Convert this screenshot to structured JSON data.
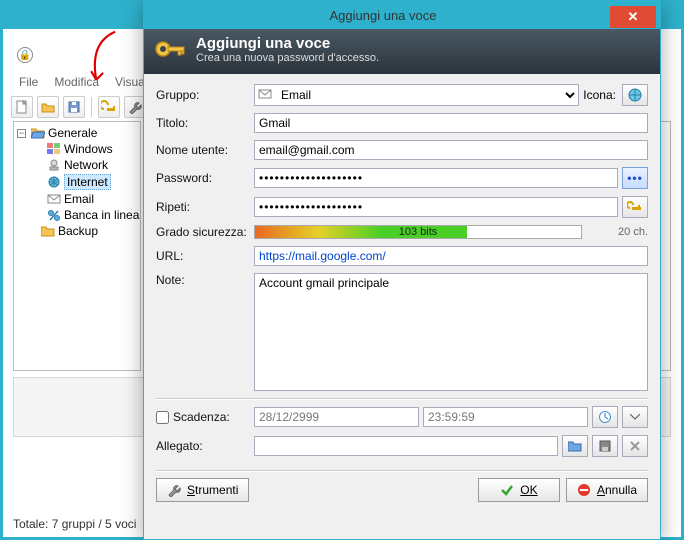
{
  "mainwin": {
    "menu": {
      "file": "File",
      "edit": "Modifica",
      "view": "Visual"
    }
  },
  "tree": {
    "root": "Generale",
    "items": [
      "Windows",
      "Network",
      "Internet",
      "Email",
      "Banca in linea"
    ],
    "backup": "Backup"
  },
  "status": "Totale: 7 gruppi / 5 voci",
  "dialog": {
    "window_title": "Aggiungi una voce",
    "heading": "Aggiungi una voce",
    "subheading": "Crea una nuova password d'accesso.",
    "labels": {
      "gruppo": "Gruppo:",
      "icona": "Icona:",
      "titolo": "Titolo:",
      "nome_utente": "Nome utente:",
      "password": "Password:",
      "ripeti": "Ripeti:",
      "grado": "Grado sicurezza:",
      "url": "URL:",
      "note": "Note:",
      "scadenza": "Scadenza:",
      "allegato": "Allegato:"
    },
    "values": {
      "gruppo": "Email",
      "titolo": "Gmail",
      "nome_utente": "email@gmail.com",
      "password": "••••••••••••••••••••",
      "ripeti": "••••••••••••••••••••",
      "strength_bits": "103 bits",
      "char_count": "20 ch.",
      "url": "https://mail.google.com/",
      "note": "Account gmail principale",
      "scadenza_date": "28/12/2999",
      "scadenza_time": "23:59:59",
      "allegato": ""
    },
    "buttons": {
      "strumenti": "Strumenti",
      "ok": "OK",
      "annulla": "Annulla"
    }
  }
}
